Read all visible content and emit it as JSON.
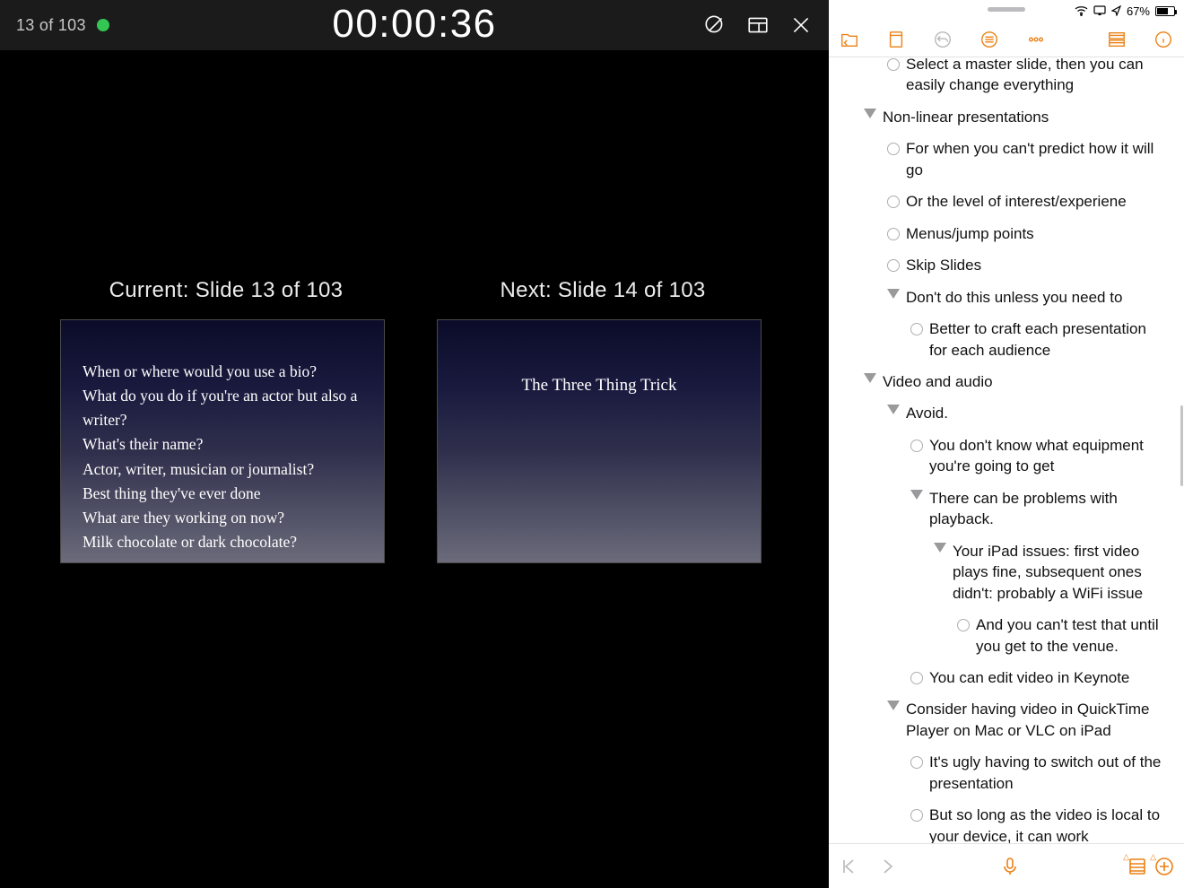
{
  "presenter": {
    "slide_counter": "13 of 103",
    "timer": "00:00:36",
    "current_label": "Current: Slide 13 of 103",
    "next_label": "Next: Slide 14 of 103",
    "current_lines": [
      "When or where would you use a bio?",
      "What do you do if you're an actor but also a writer?",
      "What's their name?",
      "Actor, writer, musician or journalist?",
      "Best thing they've ever done",
      "What are they working on now?",
      "Milk chocolate or dark chocolate?"
    ],
    "next_title": "The Three Thing Trick"
  },
  "status": {
    "battery_pct": "67%"
  },
  "outline_rows": [
    {
      "indent": 58,
      "marker": "bullet",
      "text": "Select a master slide, then you can easily change everything"
    },
    {
      "indent": 32,
      "marker": "tri",
      "text": "Non-linear presentations"
    },
    {
      "indent": 58,
      "marker": "bullet",
      "text": "For when you can't predict how it will go"
    },
    {
      "indent": 58,
      "marker": "bullet",
      "text": "Or the level of interest/experiene"
    },
    {
      "indent": 58,
      "marker": "bullet",
      "text": "Menus/jump points"
    },
    {
      "indent": 58,
      "marker": "bullet",
      "text": "Skip Slides"
    },
    {
      "indent": 58,
      "marker": "tri",
      "text": "Don't do this unless you need to"
    },
    {
      "indent": 84,
      "marker": "bullet",
      "text": "Better to craft each presentation for each audience"
    },
    {
      "indent": 32,
      "marker": "tri",
      "text": "Video and audio"
    },
    {
      "indent": 58,
      "marker": "tri",
      "text": "Avoid."
    },
    {
      "indent": 84,
      "marker": "bullet",
      "text": "You don't know what equipment you're going to get"
    },
    {
      "indent": 84,
      "marker": "tri",
      "text": "There can be problems with playback."
    },
    {
      "indent": 110,
      "marker": "tri",
      "text": "Your iPad issues: first video plays fine, subsequent ones didn't: probably a WiFi issue"
    },
    {
      "indent": 136,
      "marker": "bullet",
      "text": "And you can't test that until you get to the venue."
    },
    {
      "indent": 84,
      "marker": "bullet",
      "text": "You can edit video in Keynote"
    },
    {
      "indent": 58,
      "marker": "tri",
      "text": "Consider having video in QuickTime Player on Mac or VLC on iPad"
    },
    {
      "indent": 84,
      "marker": "bullet",
      "text": "It's ugly having to switch out of the presentation"
    },
    {
      "indent": 84,
      "marker": "bullet",
      "text": "But so long as the video is local to your device, it can work"
    }
  ]
}
